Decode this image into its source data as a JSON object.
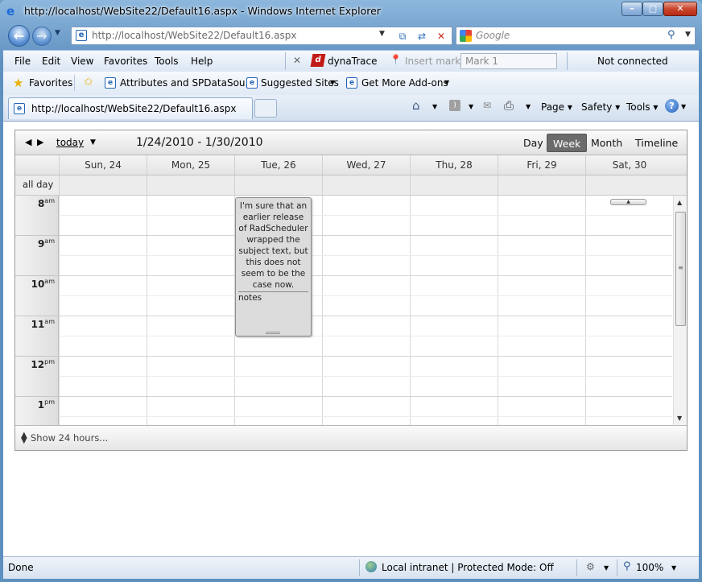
{
  "window": {
    "title": "http://localhost/WebSite22/Default16.aspx - Windows Internet Explorer",
    "controls": {
      "min": "–",
      "max": "□",
      "close": "✕"
    }
  },
  "nav": {
    "back": "←",
    "forward": "→",
    "address": "http://localhost/WebSite22/Default16.aspx",
    "search_placeholder": "Google",
    "icons": [
      "page-icon",
      "compatibility-icon",
      "refresh-icon",
      "stop-icon",
      "search-icon"
    ]
  },
  "menu": [
    "File",
    "Edit",
    "View",
    "Favorites",
    "Tools",
    "Help"
  ],
  "dynatrace": {
    "label": "dynaTrace",
    "insert_mark": "Insert mark",
    "mark_value": "Mark 1",
    "status": "Not connected"
  },
  "favorites": {
    "label": "Favorites",
    "items": [
      "Attributes and SPDataSou...",
      "Suggested Sites",
      "Get More Add-ons"
    ]
  },
  "tab": {
    "title": "http://localhost/WebSite22/Default16.aspx"
  },
  "commands": [
    "Page",
    "Safety",
    "Tools"
  ],
  "scheduler": {
    "today": "today",
    "date_range": "1/24/2010 - 1/30/2010",
    "views": [
      "Day",
      "Week",
      "Month",
      "Timeline"
    ],
    "selected_view": "Week",
    "days": [
      "Sun, 24",
      "Mon, 25",
      "Tue, 26",
      "Wed, 27",
      "Thu, 28",
      "Fri, 29",
      "Sat, 30"
    ],
    "all_day": "all day",
    "hours": [
      {
        "h": "8",
        "ap": "am"
      },
      {
        "h": "9",
        "ap": "am"
      },
      {
        "h": "10",
        "ap": "am"
      },
      {
        "h": "11",
        "ap": "am"
      },
      {
        "h": "12",
        "ap": "pm"
      },
      {
        "h": "1",
        "ap": "pm"
      }
    ],
    "appointment": {
      "day": "Tue, 26",
      "subject": "I'm sure that an earlier release of RadScheduler wrapped the subject text, but this does not seem to be the case now.",
      "notes": "notes"
    },
    "footer": "Show 24 hours..."
  },
  "status": {
    "text": "Done",
    "zone": "Local intranet | Protected Mode: Off",
    "zoom": "100%"
  }
}
